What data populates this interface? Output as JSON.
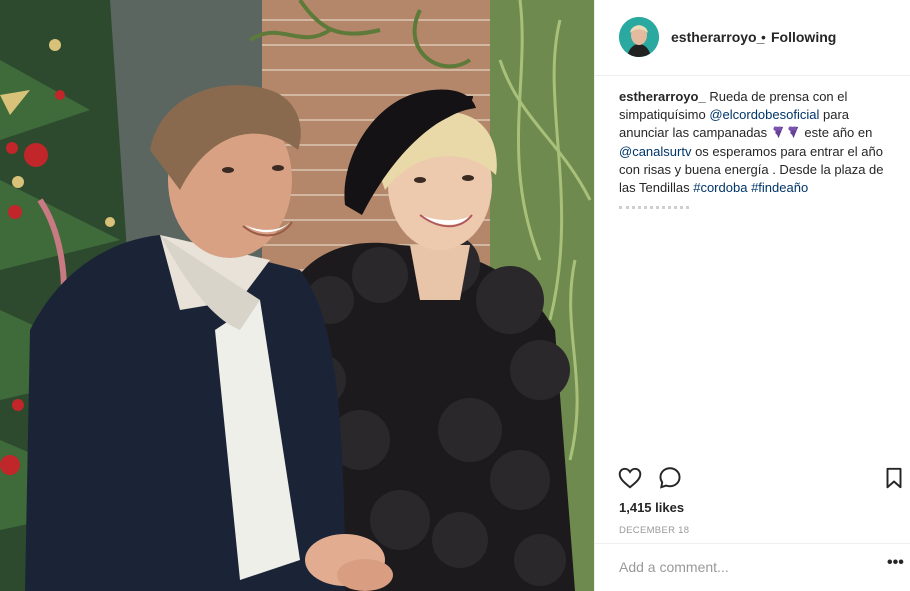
{
  "post": {
    "username": "estherarroyo_",
    "follow_dot": "•",
    "follow_status": "Following",
    "caption": {
      "username": "estherarroyo_",
      "text_1": "Rueda de prensa con el simpatiquísimo",
      "mention_1": "@elcordobesoficial",
      "text_2": "para anunciar las campanadas",
      "emoji": "grape-emoji",
      "text_3": "este año en",
      "mention_2": "@canalsurtv",
      "text_4": "os esperamos para entrar el año con risas y buena energía . Desde la plaza de las Tendillas",
      "hashtag_1": "#cordoba",
      "hashtag_2": "#findeaño"
    },
    "likes": "1,415 likes",
    "date": "December 18",
    "comment_placeholder": "Add a comment...",
    "more_icon": "•••"
  },
  "colors": {
    "link": "#003569",
    "muted": "#999999",
    "text": "#262626",
    "border": "#efefef"
  },
  "icons": [
    "heart-icon",
    "comment-icon",
    "bookmark-icon",
    "more-options-icon"
  ]
}
